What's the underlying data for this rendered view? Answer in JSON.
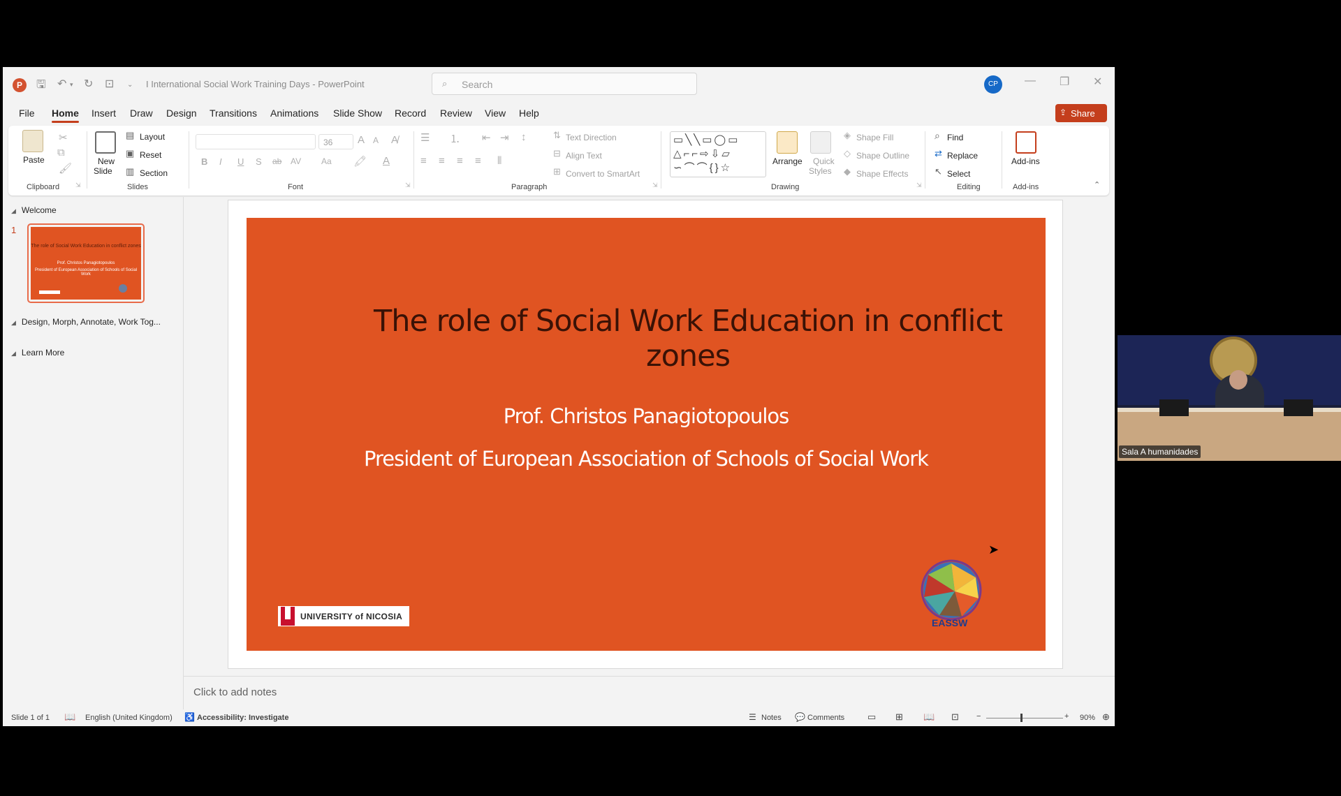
{
  "app": {
    "logo_letter": "P",
    "doc_title": "I International Social Work Training Days",
    "app_name": "PowerPoint",
    "title_sep": "-",
    "search_placeholder": "Search",
    "avatar_initials": "CP",
    "share_label": "Share",
    "accent_color": "#c43e1c"
  },
  "tabs": [
    "File",
    "Home",
    "Insert",
    "Draw",
    "Design",
    "Transitions",
    "Animations",
    "Slide Show",
    "Record",
    "Review",
    "View",
    "Help"
  ],
  "ribbon": {
    "clipboard": {
      "paste": "Paste",
      "label": "Clipboard"
    },
    "slides": {
      "new_slide_1": "New",
      "new_slide_2": "Slide",
      "layout": "Layout",
      "reset": "Reset",
      "section": "Section",
      "label": "Slides"
    },
    "font": {
      "size": "36",
      "label": "Font",
      "bold": "B",
      "italic": "I",
      "underline": "U",
      "shadow": "S",
      "strike": "ab",
      "spacing": "AV",
      "case": "Aa",
      "grow": "A",
      "shrink": "A"
    },
    "paragraph": {
      "text_direction": "Text Direction",
      "align_text": "Align Text",
      "convert_smartart": "Convert to SmartArt",
      "label": "Paragraph"
    },
    "drawing": {
      "arrange": "Arrange",
      "quick_styles_1": "Quick",
      "quick_styles_2": "Styles",
      "shape_fill": "Shape Fill",
      "shape_outline": "Shape Outline",
      "shape_effects": "Shape Effects",
      "label": "Drawing"
    },
    "editing": {
      "find": "Find",
      "replace": "Replace",
      "select": "Select",
      "label": "Editing"
    },
    "addins": {
      "addins": "Add-ins",
      "label": "Add-ins"
    }
  },
  "slide_pane": {
    "sections": [
      "Welcome",
      "Design, Morph, Annotate, Work Tog...",
      "Learn More"
    ],
    "slide_number": "1",
    "thumb": {
      "title": "The role of Social Work Education in conflict zones",
      "line1": "Prof. Christos Panagiotopoulos",
      "line2": "President of European Association of Schools of Social Work"
    }
  },
  "slide": {
    "title": "The role of Social Work Education in conflict zones",
    "name": "Prof. Christos Panagiotopoulos",
    "role": "President of European Association of Schools of Social Work",
    "logo_left": "UNIVERSITY of NICOSIA",
    "logo_right": "EASSW",
    "logo_right_ring": "European Association of Schools of Social Work",
    "bg_color": "#e05422"
  },
  "notes_placeholder": "Click to add notes",
  "status": {
    "slide_of": "Slide 1 of 1",
    "language": "English (United Kingdom)",
    "accessibility": "Accessibility: Investigate",
    "notes": "Notes",
    "comments": "Comments",
    "zoom": "90%",
    "zoom_fraction": 0.45
  },
  "video": {
    "label": "Sala A humanidades"
  }
}
